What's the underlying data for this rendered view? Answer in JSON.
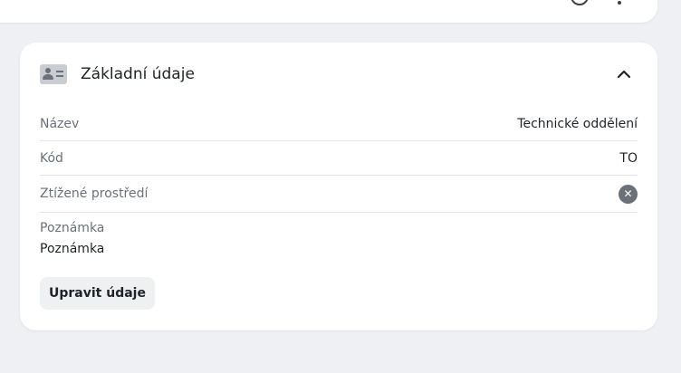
{
  "top_card": {
    "icons": [
      "clock-icon",
      "kebab-menu-icon"
    ]
  },
  "section": {
    "title": "Základní údaje",
    "icon": "id-card-icon",
    "collapse_icon": "chevron-up-icon"
  },
  "fields": [
    {
      "label": "Název",
      "value": "Technické oddělení"
    },
    {
      "label": "Kód",
      "value": "TO"
    },
    {
      "label": "Ztížené prostředí",
      "value_icon": "x-circle-icon"
    }
  ],
  "note": {
    "label": "Poznámka",
    "value": "Poznámka"
  },
  "actions": {
    "edit_label": "Upravit údaje"
  },
  "colors": {
    "background": "#eef0f3",
    "card": "#ffffff",
    "muted_text": "#6b7178",
    "divider": "#e3e6ea"
  }
}
